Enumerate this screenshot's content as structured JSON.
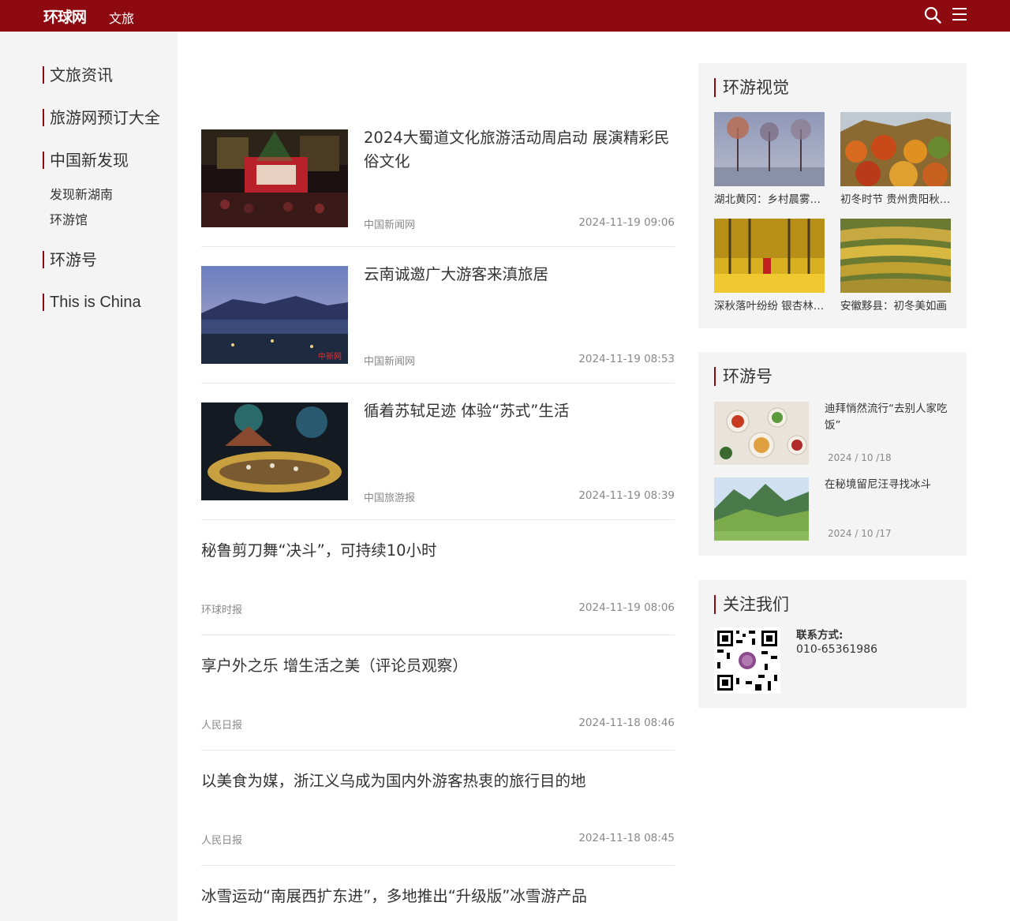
{
  "header": {
    "logo": "环球网",
    "channel": "文旅"
  },
  "sidebar": {
    "items": [
      {
        "label": "文旅资讯"
      },
      {
        "label": "旅游网预订大全"
      },
      {
        "label": "中国新发现"
      },
      {
        "label": "环游号"
      },
      {
        "label": "This is China"
      }
    ],
    "subitems": [
      {
        "label": "发现新湖南"
      },
      {
        "label": "环游馆"
      }
    ]
  },
  "articles": [
    {
      "title": "2024大蜀道文化旅游活动周启动 展演精彩民俗文化",
      "source": "中国新闻网",
      "time": "2024-11-19 09:06",
      "image": "concert-stage"
    },
    {
      "title": "云南诚邀广大游客来滇旅居",
      "source": "中国新闻网",
      "time": "2024-11-19 08:53",
      "image": "lake-town-dusk",
      "watermark": "中新网"
    },
    {
      "title": "循着苏轼足迹 体验“苏式”生活",
      "source": "中国旅游报",
      "time": "2024-11-19 08:39",
      "image": "night-performance"
    },
    {
      "title": "秘鲁剪刀舞“决斗”，可持续10小时",
      "source": "环球时报",
      "time": "2024-11-19 08:06"
    },
    {
      "title": "享户外之乐 增生活之美（评论员观察）",
      "source": "人民日报",
      "time": "2024-11-18 08:46"
    },
    {
      "title": "以美食为媒，浙江义乌成为国内外游客热衷的旅行目的地",
      "source": "人民日报",
      "time": "2024-11-18 08:45"
    },
    {
      "title": "冰雪运动“南展西扩东进”，多地推出“升级版”冰雪游产品"
    }
  ],
  "visual": {
    "title": "环游视觉",
    "items": [
      {
        "caption": "湖北黄冈：乡村晨雾如画",
        "image": "misty-trees"
      },
      {
        "caption": "初冬时节 贵州贵阳秋色正浓",
        "image": "autumn-hills"
      },
      {
        "caption": "深秋落叶纷纷 银杏林里秋意浓",
        "image": "ginkgo-forest"
      },
      {
        "caption": "安徽黟县：初冬美如画",
        "image": "terraced-fields"
      }
    ]
  },
  "huanyouhao": {
    "title": "环游号",
    "items": [
      {
        "title": "迪拜悄然流行“去别人家吃饭”",
        "date": "2024 / 10 /18",
        "image": "dinner-table"
      },
      {
        "title": "在秘境留尼汪寻找冰斗",
        "date": "2024 / 10 /17",
        "image": "green-mountains"
      }
    ]
  },
  "follow": {
    "title": "关注我们",
    "contact_label": "联系方式:",
    "phone": "010-65361986"
  },
  "colors": {
    "brand": "#8e0a11",
    "sidebar_bg": "#f4f4f4",
    "meta_text": "#888888"
  }
}
